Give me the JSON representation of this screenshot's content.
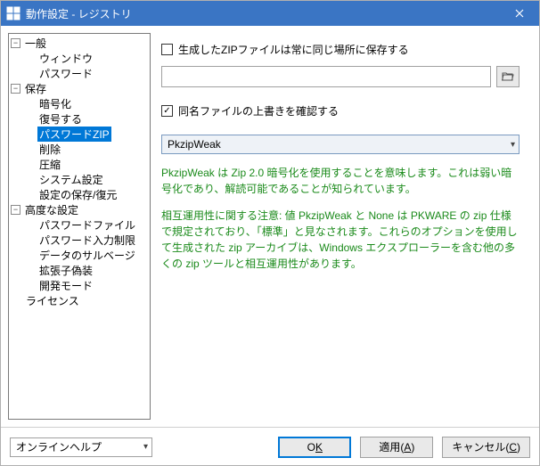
{
  "window": {
    "title": "動作設定 - レジストリ"
  },
  "tree": {
    "general": {
      "label": "一般",
      "window": "ウィンドウ",
      "password": "パスワード"
    },
    "save": {
      "label": "保存",
      "encryption": "暗号化",
      "restore": "復号する",
      "password_zip": "パスワードZIP",
      "delete": "削除",
      "compression": "圧縮",
      "system_settings": "システム設定",
      "settings_backup": "設定の保存/復元"
    },
    "advanced": {
      "label": "高度な設定",
      "password_file": "パスワードファイル",
      "password_input_limit": "パスワード入力制限",
      "data_salvage": "データのサルベージ",
      "ext_spoof": "拡張子偽装",
      "dev_mode": "開発モード"
    },
    "license": "ライセンス"
  },
  "content": {
    "cb_save_same_location": "生成したZIPファイルは常に同じ場所に保存する",
    "path_value": "",
    "cb_confirm_overwrite": "同名ファイルの上書きを確認する",
    "algo_selected": "PkzipWeak",
    "info1": "PkzipWeak は Zip 2.0 暗号化を使用することを意味します。これは弱い暗号化であり、解読可能であることが知られています。",
    "info2": "相互運用性に関する注意: 値 PkzipWeak と None は PKWARE の zip 仕様 で規定されており、「標準」と見なされます。これらのオプションを使用して生成された zip アーカイブは、Windows エクスプローラーを含む他の多くの zip ツールと相互運用性があります。"
  },
  "bottom": {
    "help": "オンラインヘルプ",
    "ok_pre": "O",
    "ok_key": "K",
    "apply_pre": "適用(",
    "apply_key": "A",
    "apply_post": ")",
    "cancel_pre": "キャンセル(",
    "cancel_key": "C",
    "cancel_post": ")"
  }
}
